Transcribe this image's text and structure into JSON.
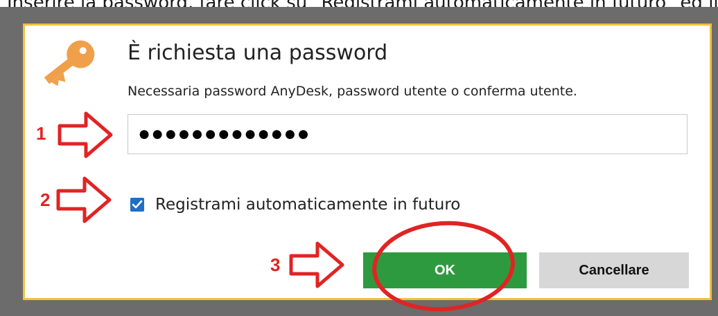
{
  "caption": {
    "text": "Inserire la password, fare click su \"Registrami automaticamente in futuro\" ed il"
  },
  "dialog": {
    "title": "È richiesta una password",
    "subtitle": "Necessaria password AnyDesk, password utente o conferma utente.",
    "password": {
      "value": "●●●●●●●●●●●●●",
      "masked": true
    },
    "remember": {
      "label": "Registrami automaticamente in futuro",
      "checked": true
    },
    "buttons": {
      "ok": "OK",
      "cancel": "Cancellare"
    },
    "icon": "key-icon"
  },
  "annotations": {
    "steps": [
      "1",
      "2",
      "3"
    ],
    "color": "#e02424",
    "highlight": "ok-button"
  },
  "colors": {
    "border_accent": "#f0c23c",
    "ok_green": "#2e9a3f",
    "checkbox_blue": "#1f6fc6",
    "key_orange": "#f0a04b"
  }
}
